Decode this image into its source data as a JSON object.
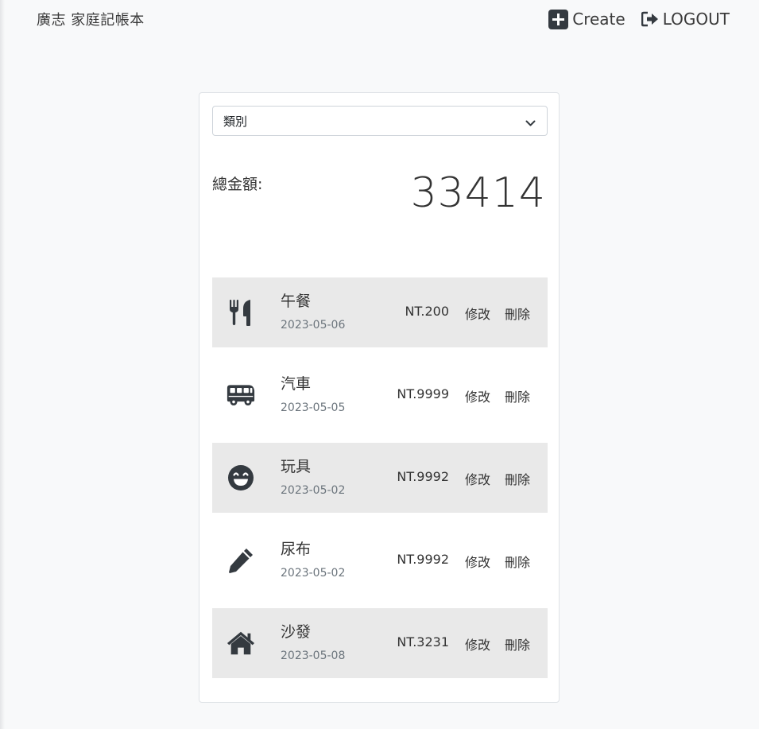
{
  "header": {
    "brand": "廣志 家庭記帳本",
    "create_label": "Create",
    "logout_label": "LOGOUT"
  },
  "filter": {
    "selected": "類別"
  },
  "summary": {
    "total_label": "總金額:",
    "total_value": "33414"
  },
  "records": [
    {
      "icon": "utensils-icon",
      "name": "午餐",
      "date": "2023-05-06",
      "amount": "NT.200",
      "edit_label": "修改",
      "delete_label": "刪除"
    },
    {
      "icon": "van-icon",
      "name": "汽車",
      "date": "2023-05-05",
      "amount": "NT.9999",
      "edit_label": "修改",
      "delete_label": "刪除"
    },
    {
      "icon": "smile-icon",
      "name": "玩具",
      "date": "2023-05-02",
      "amount": "NT.9992",
      "edit_label": "修改",
      "delete_label": "刪除"
    },
    {
      "icon": "pencil-icon",
      "name": "尿布",
      "date": "2023-05-02",
      "amount": "NT.9992",
      "edit_label": "修改",
      "delete_label": "刪除"
    },
    {
      "icon": "house-icon",
      "name": "沙發",
      "date": "2023-05-08",
      "amount": "NT.3231",
      "edit_label": "修改",
      "delete_label": "刪除"
    }
  ],
  "colors": {
    "page_bg": "#f8f9fa",
    "row_shade": "#e9e9e9",
    "icon": "#343a40"
  }
}
